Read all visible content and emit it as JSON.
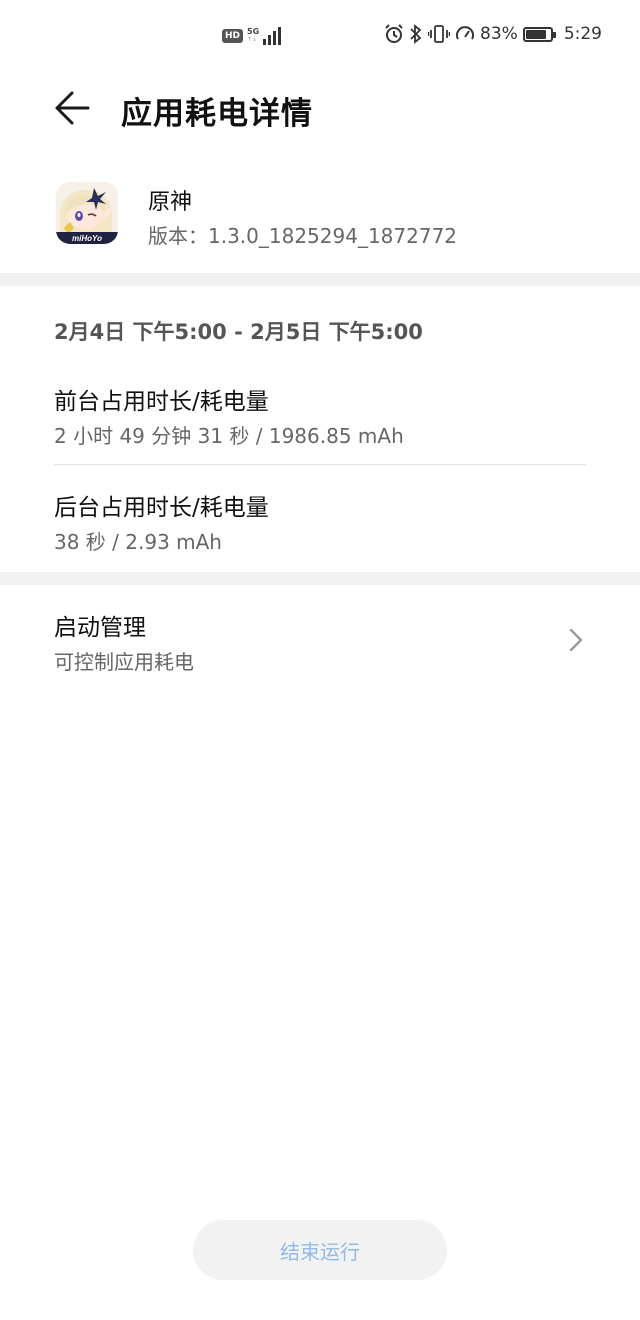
{
  "status_bar": {
    "hd_badge": "HD",
    "network_type": "5G",
    "network_sub": "↑↓",
    "battery_percent": "83%",
    "battery_level": 0.83,
    "time": "5:29",
    "icons": [
      "alarm-icon",
      "bluetooth-icon",
      "vibrate-icon",
      "speed-icon",
      "battery-icon",
      "signal-icon"
    ]
  },
  "header": {
    "title": "应用耗电详情",
    "back_icon": "back-arrow-icon"
  },
  "app": {
    "name": "原神",
    "version": "版本：1.3.0_1825294_1872772",
    "icon_text": "miHoYo"
  },
  "usage": {
    "date_range": "2月4日 下午5:00 - 2月5日 下午5:00",
    "foreground": {
      "title": "前台占用时长/耗电量",
      "value": "2 小时 49 分钟 31 秒 / 1986.85 mAh"
    },
    "background": {
      "title": "后台占用时长/耗电量",
      "value": "38 秒 / 2.93 mAh"
    }
  },
  "startup": {
    "title": "启动管理",
    "subtitle": "可控制应用耗电"
  },
  "end_button": {
    "label": "结束运行"
  },
  "colors": {
    "accent_disabled": "#93b9e6",
    "divider": "#f1f1f1"
  }
}
